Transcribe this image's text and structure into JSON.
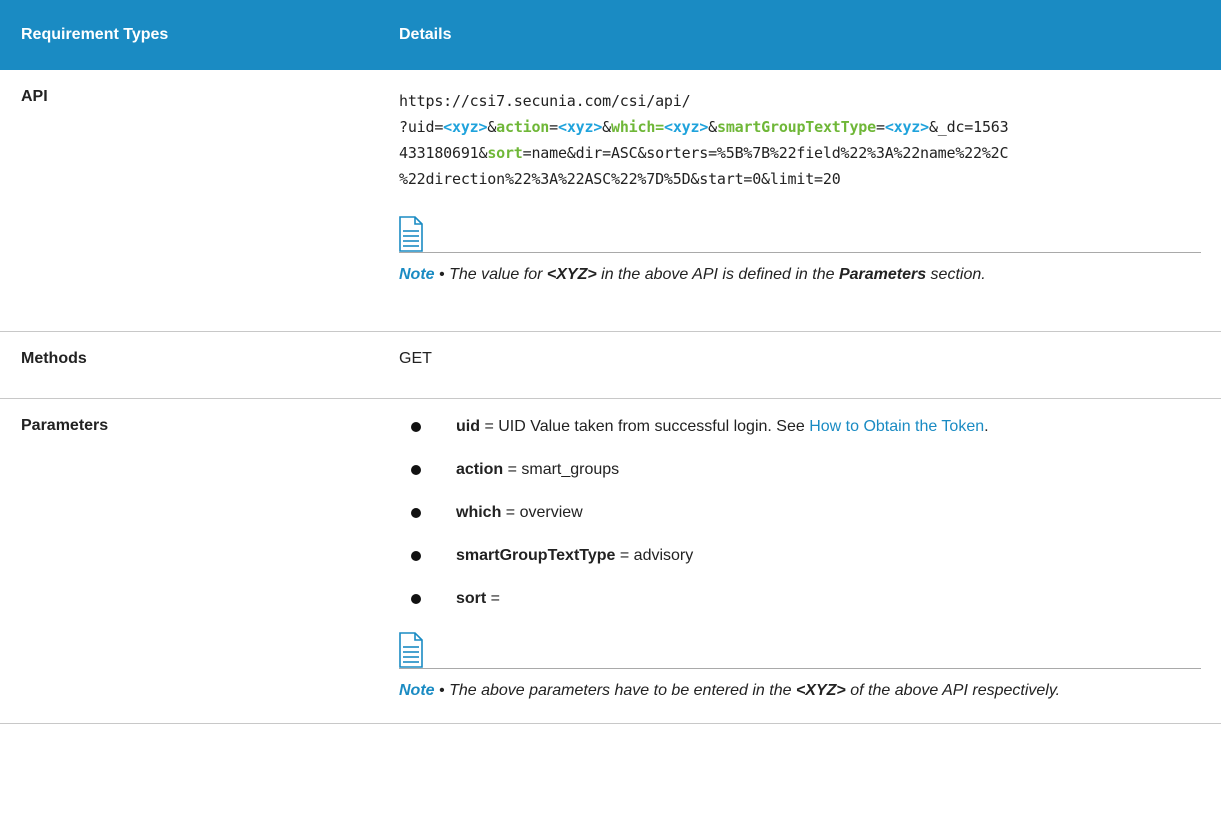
{
  "header": {
    "col1": "Requirement Types",
    "col2": "Details"
  },
  "api_row": {
    "label": "API",
    "url_line1": "https://csi7.secunia.com/csi/api/",
    "url_line2_parts": {
      "p0": "?uid=",
      "p1": "<xyz>",
      "p2": "&",
      "p3": "action",
      "p4": "=",
      "p5": "<xyz>",
      "p6": "&",
      "p7": "which=",
      "p8": "<xyz>",
      "p9": "&",
      "p10": "smartGroupTextType",
      "p11": "=",
      "p12": "<xyz>",
      "p13": "&_dc=1563"
    },
    "url_line3_parts": {
      "p0": "433180691&",
      "p1": "sort",
      "p2": "=name&dir=ASC&sorters=%5B%7B%22field%22%3A%22name%22%2C"
    },
    "url_line4": "%22direction%22%3A%22ASC%22%7D%5D&start=0&limit=20",
    "note": {
      "label": "Note",
      "bullet": " • ",
      "t1": "The value for ",
      "xyz": "<XYZ>",
      "t2": " in the above API is defined in the ",
      "params": "Parameters",
      "t3": " section."
    }
  },
  "methods_row": {
    "label": "Methods",
    "value": "GET"
  },
  "parameters_row": {
    "label": "Parameters",
    "items": [
      {
        "name": "uid",
        "eq": " = ",
        "value": "UID Value taken from successful login. See ",
        "link": "How to Obtain the Token",
        "end": "."
      },
      {
        "name": "action",
        "eq": " = ",
        "value": "smart_groups"
      },
      {
        "name": "which",
        "eq": " = ",
        "value": "overview"
      },
      {
        "name": "smartGroupTextType",
        "eq": " = ",
        "value": "advisory"
      },
      {
        "name": "sort",
        "eq": " =",
        "value": ""
      }
    ],
    "note": {
      "label": "Note",
      "bullet": " • ",
      "t1": "The above parameters have to be entered in the ",
      "xyz": "<XYZ>",
      "t2": " of the above API respectively."
    }
  },
  "icons": {
    "note_icon": "document-note-icon",
    "bullet": "bullet-dot"
  }
}
